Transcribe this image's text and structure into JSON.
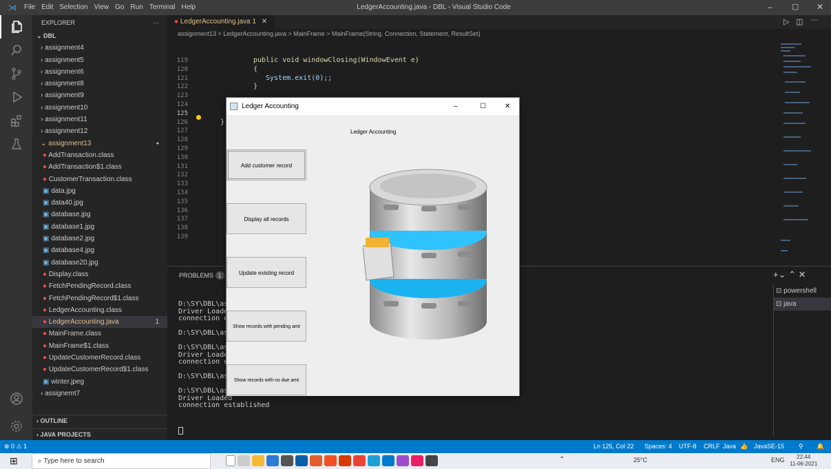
{
  "window": {
    "menu": [
      "File",
      "Edit",
      "Selection",
      "View",
      "Go",
      "Run",
      "Terminal",
      "Help"
    ],
    "title": "LedgerAccounting.java - DBL - Visual Studio Code"
  },
  "sidebar": {
    "header": "EXPLORER",
    "root": "DBL",
    "items": [
      {
        "label": "assignment4",
        "kind": "folder"
      },
      {
        "label": "assignment5",
        "kind": "folder"
      },
      {
        "label": "assignment6",
        "kind": "folder"
      },
      {
        "label": "assignment8",
        "kind": "folder"
      },
      {
        "label": "assignment9",
        "kind": "folder"
      },
      {
        "label": "assignment10",
        "kind": "folder"
      },
      {
        "label": "assignment11",
        "kind": "folder"
      },
      {
        "label": "assignment12",
        "kind": "folder"
      },
      {
        "label": "assignment13",
        "kind": "folder-open"
      },
      {
        "label": "AddTransaction.class",
        "kind": "class"
      },
      {
        "label": "AddTransaction$1.class",
        "kind": "class"
      },
      {
        "label": "CustomerTransaction.class",
        "kind": "class"
      },
      {
        "label": "data.jpg",
        "kind": "image"
      },
      {
        "label": "data40.jpg",
        "kind": "image"
      },
      {
        "label": "database.jpg",
        "kind": "image"
      },
      {
        "label": "database1.jpg",
        "kind": "image"
      },
      {
        "label": "database2.jpg",
        "kind": "image"
      },
      {
        "label": "database4.jpg",
        "kind": "image"
      },
      {
        "label": "database20.jpg",
        "kind": "image"
      },
      {
        "label": "Display.class",
        "kind": "class"
      },
      {
        "label": "FetchPendingRecord.class",
        "kind": "class"
      },
      {
        "label": "FetchPendingRecord$1.class",
        "kind": "class"
      },
      {
        "label": "LedgerAccounting.class",
        "kind": "class"
      },
      {
        "label": "LedgerAccounting.java",
        "kind": "java"
      },
      {
        "label": "MainFrame.class",
        "kind": "class"
      },
      {
        "label": "MainFrame$1.class",
        "kind": "class"
      },
      {
        "label": "UpdateCustomerRecord.class",
        "kind": "class"
      },
      {
        "label": "UpdateCustomerRecord$1.class",
        "kind": "class"
      },
      {
        "label": "winter.jpeg",
        "kind": "image"
      },
      {
        "label": "assignemt7",
        "kind": "folder"
      }
    ],
    "java_badge": "1",
    "outline": "OUTLINE",
    "projects": "JAVA PROJECTS"
  },
  "editor": {
    "tab": "LedgerAccounting.java 1",
    "breadcrumb": "assignment13 > LedgerAccounting.java > MainFrame > MainFrame(String, Connection, Statement, ResultSet)",
    "line_numbers": [
      "119",
      "120",
      "121",
      "122",
      "123",
      "124",
      "125",
      "126",
      "127",
      "128",
      "129",
      "130",
      "131",
      "132",
      "133",
      "134",
      "135",
      "136",
      "137",
      "138",
      "139"
    ],
    "lines": [
      "public void windowClosing(WindowEvent e)",
      "{",
      "System.exit(0);;",
      "}",
      "",
      "",
      "",
      "}",
      "",
      "",
      "",
      "",
      "",
      "",
      "",
      "",
      "",
      "",
      "",
      "",
      ""
    ]
  },
  "panel": {
    "problems_label": "PROBLEMS",
    "problems_count": "1",
    "terminal": "D:\\SY\\DBL\\as\nDriver Loade\nconnection e\n\nD:\\SY\\DBL\\as\n\nD:\\SY\\DBL\\as\nDriver Loade\nconnection e\n\nD:\\SY\\DBL\\as\n\nD:\\SY\\DBL\\assignment13>java LedgerAccounting\nDriver Loaded\nconnection established\n",
    "tabs": [
      "powershell",
      "java"
    ]
  },
  "status": {
    "errors": "0",
    "warnings": "1",
    "position": "Ln 125, Col 22",
    "spaces": "Spaces: 4",
    "encoding": "UTF-8",
    "eol": "CRLF",
    "lang": "Java",
    "jdk": "JavaSE-15"
  },
  "taskbar": {
    "search": "Type here to search",
    "weather": "25°C",
    "lang": "ENG",
    "time": "22:44",
    "date": "11-06-2021"
  },
  "java_window": {
    "title": "Ledger Accounting",
    "heading": "Ledger Accounting",
    "buttons": [
      "Add customer record",
      "Display all records",
      "Update existing record",
      "Show records with pending amt",
      "Show records with no due amt"
    ]
  },
  "colors": {
    "accent": "#007acc",
    "taskbar": "#e9ecf2"
  }
}
